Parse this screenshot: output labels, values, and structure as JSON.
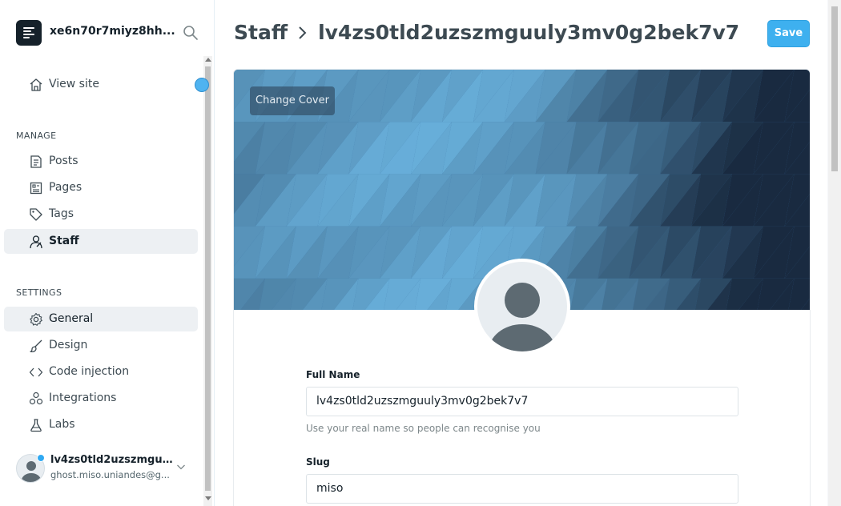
{
  "site": {
    "title": "xe6n70r7miyz8hh...",
    "logo_icon": "ghost-logo-icon",
    "search_icon": "search-icon"
  },
  "sidebar": {
    "view_site": {
      "label": "View site",
      "icon": "home-icon"
    },
    "manage_header": "MANAGE",
    "manage_items": [
      {
        "label": "Posts",
        "icon": "posts-icon",
        "active": false
      },
      {
        "label": "Pages",
        "icon": "pages-icon",
        "active": false
      },
      {
        "label": "Tags",
        "icon": "tag-icon",
        "active": false
      },
      {
        "label": "Staff",
        "icon": "staff-icon",
        "active": true
      }
    ],
    "settings_header": "SETTINGS",
    "settings_items": [
      {
        "label": "General",
        "icon": "gear-icon",
        "active": true
      },
      {
        "label": "Design",
        "icon": "brush-icon",
        "active": false
      },
      {
        "label": "Code injection",
        "icon": "code-icon",
        "active": false
      },
      {
        "label": "Integrations",
        "icon": "integrations-icon",
        "active": false
      },
      {
        "label": "Labs",
        "icon": "flask-icon",
        "active": false
      }
    ],
    "user": {
      "name": "lv4zs0tld2uzszmguul...",
      "email": "ghost.miso.uniandes@g..."
    }
  },
  "header": {
    "breadcrumb": "Staff",
    "title": "lv4zs0tld2uzszmguuly3mv0g2bek7v7",
    "save_label": "Save"
  },
  "profile": {
    "change_cover_label": "Change Cover",
    "full_name_label": "Full Name",
    "full_name_value": "lv4zs0tld2uzszmguuly3mv0g2bek7v7",
    "full_name_help": "Use your real name so people can recognise you",
    "slug_label": "Slug",
    "slug_value": "miso"
  },
  "colors": {
    "accent": "#3eb0ef",
    "dark": "#15212a",
    "cover_base": "#3a6fa0"
  }
}
